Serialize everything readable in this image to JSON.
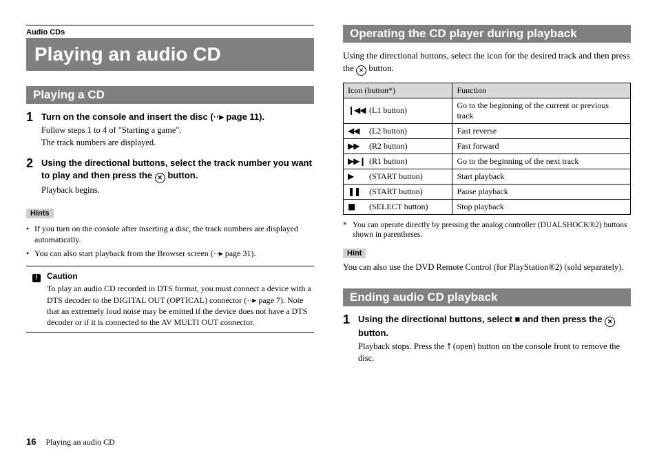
{
  "left": {
    "eyebrow": "Audio CDs",
    "title": "Playing an audio CD",
    "sec1_title": "Playing a CD",
    "step1_num": "1",
    "step1_head": "Turn on the console and insert the disc (··▸ page 11).",
    "step1_line1": "Follow steps 1 to 4 of \"Starting a game\".",
    "step1_line2": "The track numbers are displayed.",
    "step2_num": "2",
    "step2_head_a": "Using the directional buttons, select the track number you want to play and then press the ",
    "step2_head_b": " button.",
    "step2_line1": "Playback begins.",
    "hints_label": "Hints",
    "hint1": "If you turn on the console after inserting a disc, the track numbers are displayed automatically.",
    "hint2": "You can also start playback from the Browser screen (··▸ page 31).",
    "caution_title": "Caution",
    "caution_body": "To play an audio CD recorded in DTS format, you must connect a device with a DTS decoder to the DIGITAL OUT (OPTICAL) connector (··▸ page 7). Note that an extremely loud noise may be emitted if the device does not have a DTS decoder or if it is connected to the AV MULTI OUT connector."
  },
  "right": {
    "sec1_title": "Operating the CD player during playback",
    "intro_a": "Using the directional buttons, select the icon for the desired track and then press the ",
    "intro_b": " button.",
    "th_icon": "Icon   (button*)",
    "th_func": "Function",
    "rows": [
      {
        "icon": "❙◀◀",
        "btn": "(L1 button)",
        "func": "Go to the beginning of the current or previous track"
      },
      {
        "icon": "◀◀",
        "btn": "(L2 button)",
        "func": "Fast reverse"
      },
      {
        "icon": "▶▶",
        "btn": "(R2 button)",
        "func": "Fast forward"
      },
      {
        "icon": "▶▶❙",
        "btn": "(R1 button)",
        "func": "Go to the beginning of the next track"
      },
      {
        "icon": "▶",
        "btn": "(START button)",
        "func": "Start playback"
      },
      {
        "icon": "❚❚",
        "btn": "(START button)",
        "func": "Pause playback"
      },
      {
        "icon": "■",
        "btn": "(SELECT button)",
        "func": "Stop playback"
      }
    ],
    "note": "You can operate directly by pressing the analog controller (DUALSHOCK®2) buttons shown in parentheses.",
    "hint_label": "Hint",
    "hint_body": "You can also use the DVD Remote Control (for PlayStation®2) (sold separately).",
    "sec2_title": "Ending audio CD playback",
    "end_step_num": "1",
    "end_head_a": "Using the directional buttons, select ■ and then press the ",
    "end_head_b": " button.",
    "end_line": "Playback stops. Press the ⭡ (open) button on the console front to remove the disc."
  },
  "footer": {
    "page": "16",
    "title": "Playing an audio CD"
  },
  "glyphs": {
    "x_btn": "✕",
    "caution_mark": "!",
    "bullet": "•",
    "star": "*"
  }
}
